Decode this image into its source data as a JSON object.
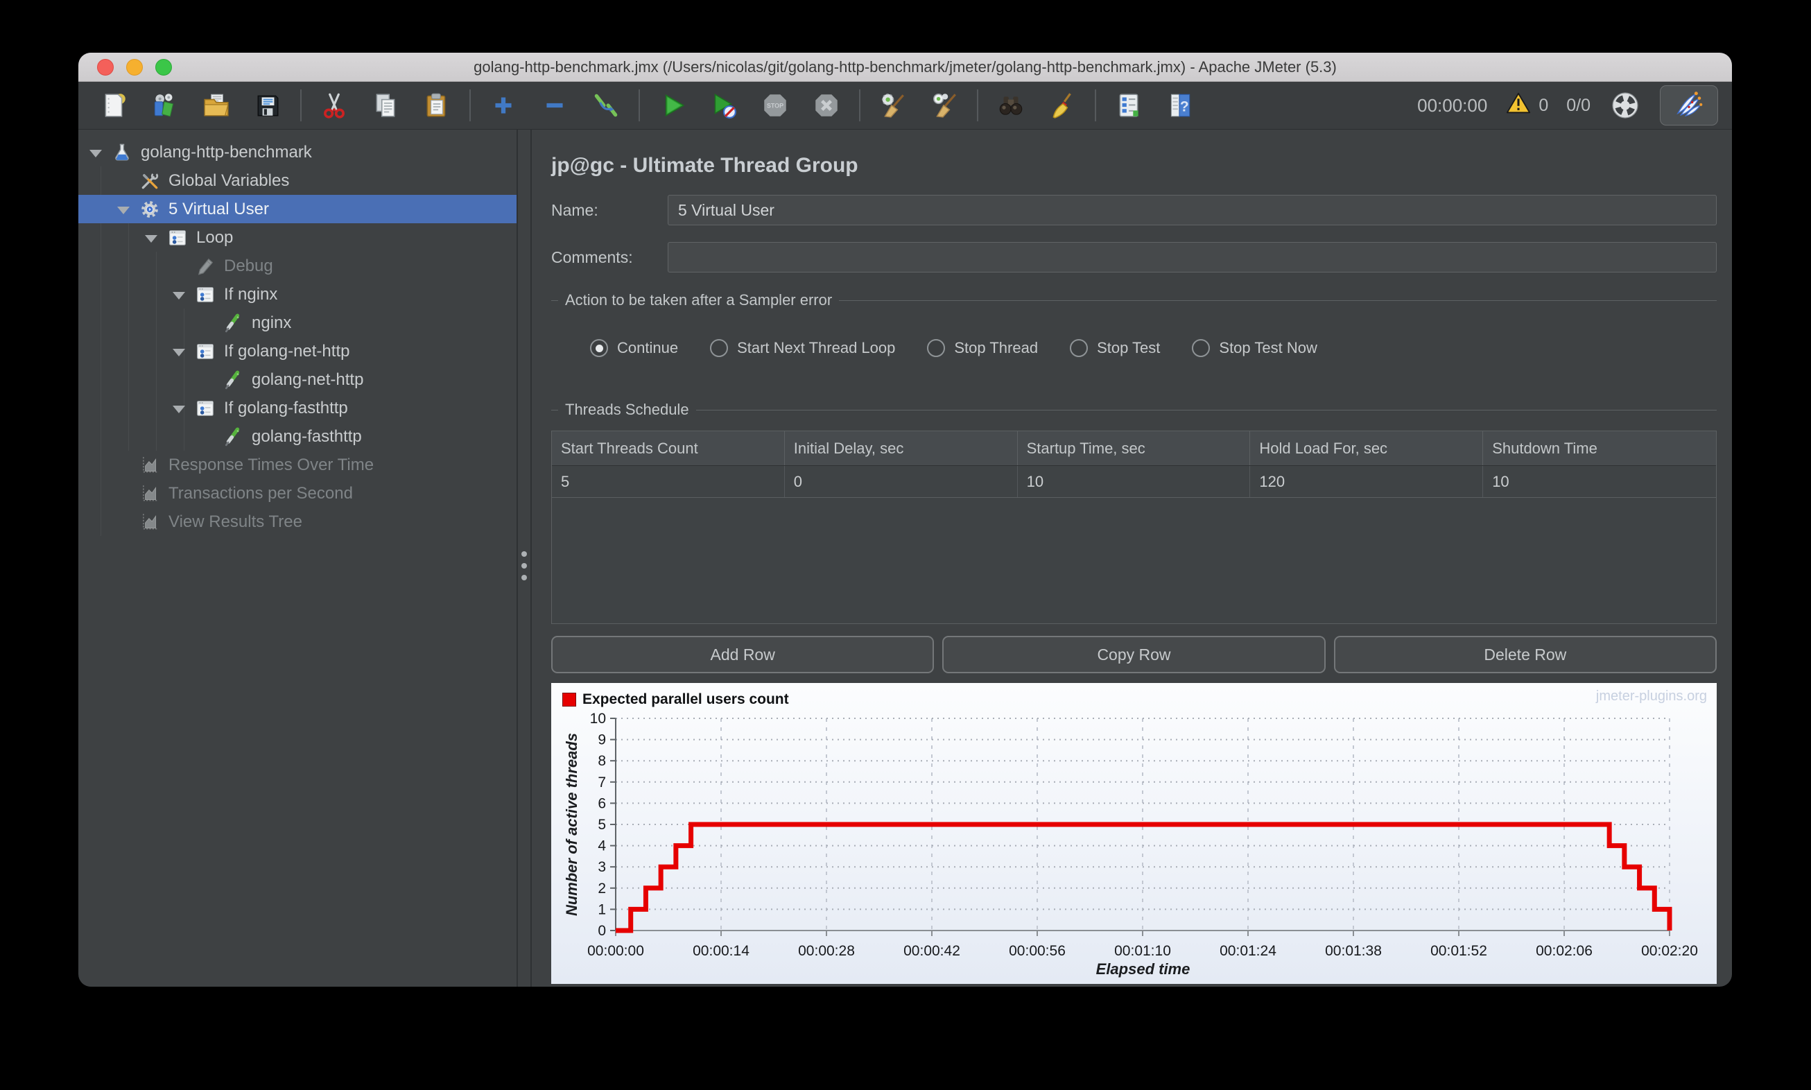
{
  "window": {
    "title": "golang-http-benchmark.jmx (/Users/nicolas/git/golang-http-benchmark/jmeter/golang-http-benchmark.jmx) - Apache JMeter (5.3)"
  },
  "toolbar": {
    "groups": [
      [
        "new-file",
        "templates",
        "open-file",
        "save"
      ],
      [
        "cut",
        "copy",
        "paste"
      ],
      [
        "add",
        "remove",
        "toggle"
      ],
      [
        "start",
        "start-no-timers",
        "stop",
        "shutdown"
      ],
      [
        "clear",
        "clear-all"
      ],
      [
        "search",
        "search-reset"
      ],
      [
        "function-helper",
        "help"
      ]
    ],
    "disabled_icons": [
      "stop",
      "shutdown"
    ],
    "timer": "00:00:00",
    "warning_count": "0",
    "thread_ratio": "0/0"
  },
  "tree": {
    "items": [
      {
        "label": "golang-http-benchmark",
        "icon": "test-plan",
        "level": 0,
        "expanded": true
      },
      {
        "label": "Global Variables",
        "icon": "setup-tools",
        "level": 1
      },
      {
        "label": "5 Virtual User",
        "icon": "thread-gear",
        "level": 1,
        "expanded": true,
        "selected": true
      },
      {
        "label": "Loop",
        "icon": "controller",
        "level": 2,
        "expanded": true
      },
      {
        "label": "Debug",
        "icon": "pencil",
        "level": 3,
        "disabled": true
      },
      {
        "label": "If nginx",
        "icon": "controller",
        "level": 3,
        "expanded": true
      },
      {
        "label": "nginx",
        "icon": "sampler",
        "level": 4
      },
      {
        "label": "If golang-net-http",
        "icon": "controller",
        "level": 3,
        "expanded": true
      },
      {
        "label": "golang-net-http",
        "icon": "sampler",
        "level": 4
      },
      {
        "label": "If golang-fasthttp",
        "icon": "controller",
        "level": 3,
        "expanded": true
      },
      {
        "label": "golang-fasthttp",
        "icon": "sampler",
        "level": 4
      },
      {
        "label": "Response Times Over Time",
        "icon": "listener-chart",
        "level": 1,
        "disabled": true
      },
      {
        "label": "Transactions per Second",
        "icon": "listener-chart",
        "level": 1,
        "disabled": true
      },
      {
        "label": "View Results Tree",
        "icon": "listener-chart",
        "level": 1,
        "disabled": true
      }
    ]
  },
  "panel": {
    "title": "jp@gc - Ultimate Thread Group",
    "name_label": "Name:",
    "name_value": "5 Virtual User",
    "comments_label": "Comments:",
    "comments_value": "",
    "error_action": {
      "title": "Action to be taken after a Sampler error",
      "options": [
        {
          "label": "Continue",
          "selected": true
        },
        {
          "label": "Start Next Thread Loop",
          "selected": false
        },
        {
          "label": "Stop Thread",
          "selected": false
        },
        {
          "label": "Stop Test",
          "selected": false
        },
        {
          "label": "Stop Test Now",
          "selected": false
        }
      ]
    },
    "schedule": {
      "title": "Threads Schedule",
      "columns": [
        "Start Threads Count",
        "Initial Delay, sec",
        "Startup Time, sec",
        "Hold Load For, sec",
        "Shutdown Time"
      ],
      "rows": [
        [
          "5",
          "0",
          "10",
          "120",
          "10"
        ]
      ]
    },
    "row_buttons": [
      "Add Row",
      "Copy Row",
      "Delete Row"
    ]
  },
  "chart_data": {
    "type": "line",
    "subtype": "step",
    "legend": "Expected parallel users count",
    "watermark": "jmeter-plugins.org",
    "xlabel": "Elapsed time",
    "ylabel": "Number of active threads",
    "ylim": [
      0,
      10
    ],
    "yticks": [
      0,
      1,
      2,
      3,
      4,
      5,
      6,
      7,
      8,
      9,
      10
    ],
    "xlim_sec": [
      0,
      140
    ],
    "xtick_labels": [
      "00:00:00",
      "00:00:14",
      "00:00:28",
      "00:00:42",
      "00:00:56",
      "00:01:10",
      "00:01:24",
      "00:01:38",
      "00:01:52",
      "00:02:06",
      "00:02:20"
    ],
    "grid": true,
    "legend_position": "top-left",
    "series": [
      {
        "name": "Expected parallel users count",
        "color": "#E60000",
        "points_time_value": [
          [
            0,
            0
          ],
          [
            2,
            1
          ],
          [
            4,
            2
          ],
          [
            6,
            3
          ],
          [
            8,
            4
          ],
          [
            10,
            5
          ],
          [
            132,
            4
          ],
          [
            134,
            3
          ],
          [
            136,
            2
          ],
          [
            138,
            1
          ],
          [
            140,
            0
          ]
        ]
      }
    ]
  },
  "colors": {
    "selection_blue": "#4A6FB5",
    "series_red": "#E60000",
    "traffic_close": "#F4605A",
    "traffic_min": "#F6B02F",
    "traffic_max": "#3BC648"
  }
}
